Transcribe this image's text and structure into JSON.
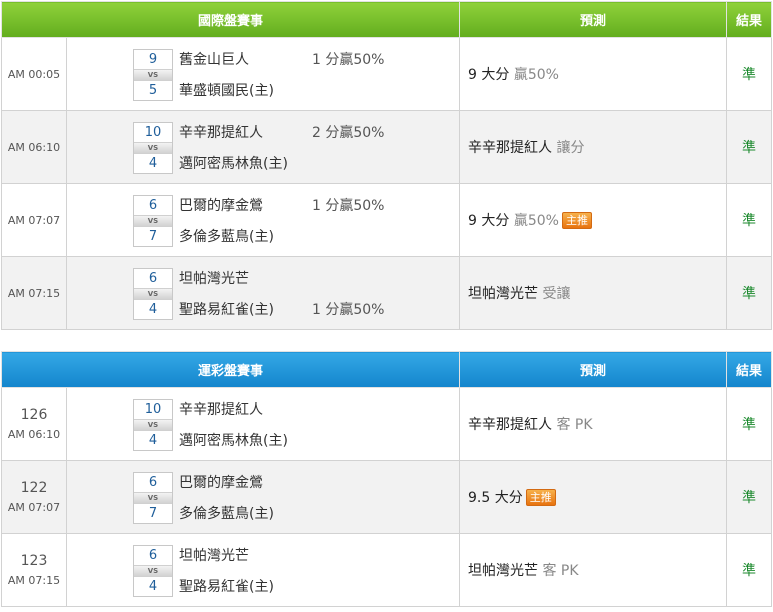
{
  "international": {
    "header": {
      "event": "國際盤賽事",
      "prediction": "預測",
      "result": "結果"
    },
    "rows": [
      {
        "time": "AM 00:05",
        "away_score": "9",
        "home_score": "5",
        "vs": "VS",
        "away": "舊金山巨人",
        "home": "華盛頓國民(主)",
        "odds": "1 分贏50%",
        "pred_main": "9 大分",
        "pred_sub": "贏50%",
        "badge": "",
        "result": "準"
      },
      {
        "time": "AM 06:10",
        "away_score": "10",
        "home_score": "4",
        "vs": "VS",
        "away": "辛辛那提紅人",
        "home": "邁阿密馬林魚(主)",
        "odds": "2 分贏50%",
        "pred_main": "辛辛那提紅人",
        "pred_sub": "讓分",
        "badge": "",
        "result": "準"
      },
      {
        "time": "AM 07:07",
        "away_score": "6",
        "home_score": "7",
        "vs": "VS",
        "away": "巴爾的摩金鶯",
        "home": "多倫多藍鳥(主)",
        "odds": "1 分贏50%",
        "pred_main": "9 大分",
        "pred_sub": "贏50%",
        "badge": "主推",
        "result": "準"
      },
      {
        "time": "AM 07:15",
        "away_score": "6",
        "home_score": "4",
        "vs": "VS",
        "away": "坦帕灣光芒",
        "home": "聖路易紅雀(主)",
        "odds": "1 分贏50%",
        "pred_main": "坦帕灣光芒",
        "pred_sub": "受讓",
        "badge": "",
        "result": "準"
      }
    ]
  },
  "lottery": {
    "header": {
      "event": "運彩盤賽事",
      "prediction": "預測",
      "result": "結果"
    },
    "rows": [
      {
        "num": "126",
        "time": "AM 06:10",
        "away_score": "10",
        "home_score": "4",
        "vs": "VS",
        "away": "辛辛那提紅人",
        "home": "邁阿密馬林魚(主)",
        "pred_main": "辛辛那提紅人",
        "pred_sub": "客 PK",
        "badge": "",
        "result": "準"
      },
      {
        "num": "122",
        "time": "AM 07:07",
        "away_score": "6",
        "home_score": "7",
        "vs": "VS",
        "away": "巴爾的摩金鶯",
        "home": "多倫多藍鳥(主)",
        "pred_main": "9.5 大分",
        "pred_sub": "",
        "badge": "主推",
        "result": "準"
      },
      {
        "num": "123",
        "time": "AM 07:15",
        "away_score": "6",
        "home_score": "4",
        "vs": "VS",
        "away": "坦帕灣光芒",
        "home": "聖路易紅雀(主)",
        "pred_main": "坦帕灣光芒",
        "pred_sub": "客 PK",
        "badge": "",
        "result": "準"
      }
    ]
  },
  "colors": {
    "green_header": "#7cc52c",
    "blue_header": "#1f95d8",
    "result_text": "#1c8a2e",
    "score_text": "#1f5e9a",
    "badge": "#ef8a1f"
  }
}
